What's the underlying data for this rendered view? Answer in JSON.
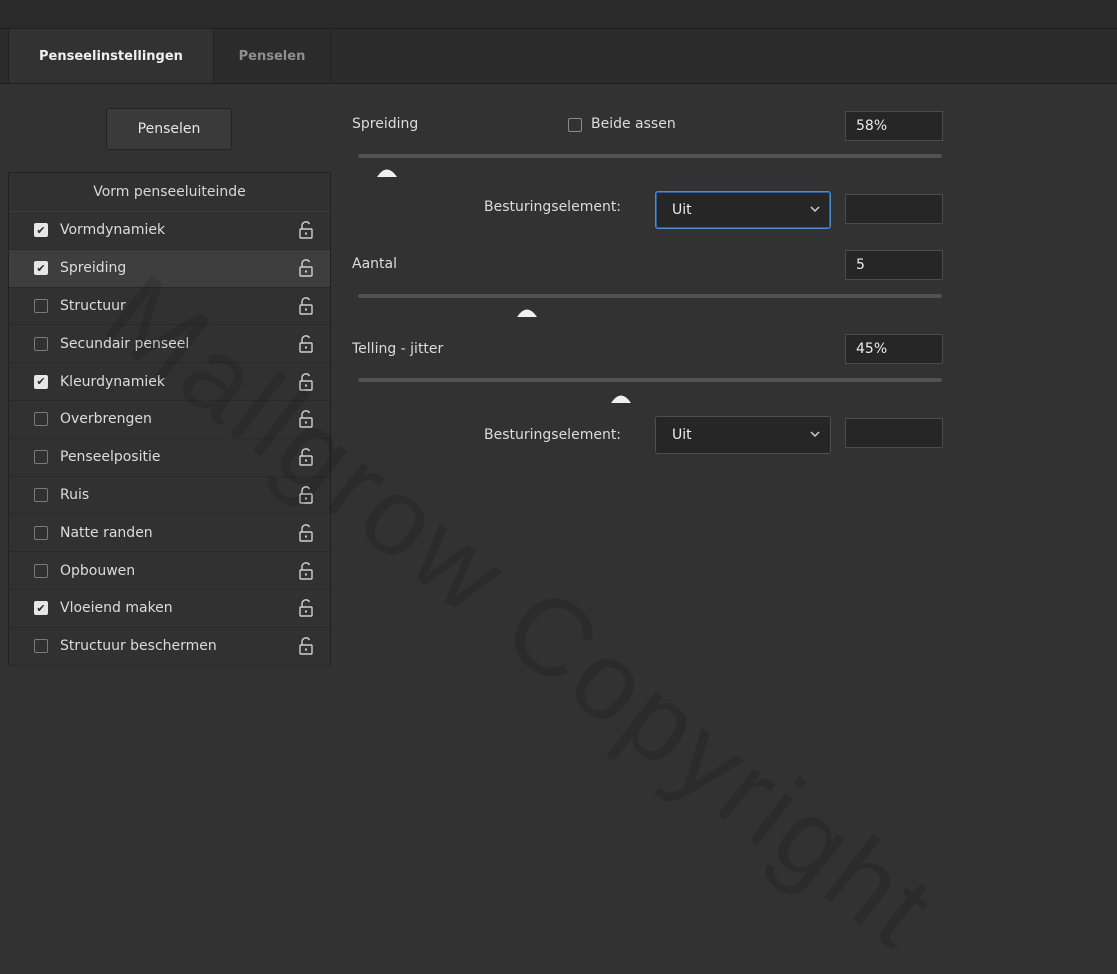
{
  "tabs": [
    {
      "label": "Penseelinstellingen",
      "active": true
    },
    {
      "label": "Penselen",
      "active": false
    }
  ],
  "brushes_button": "Penselen",
  "brush_tip_shape": "Vorm penseeluiteinde",
  "options": [
    {
      "label": "Vormdynamiek",
      "checked": true
    },
    {
      "label": "Spreiding",
      "checked": true,
      "selected": true
    },
    {
      "label": "Structuur",
      "checked": false
    },
    {
      "label": "Secundair penseel",
      "checked": false
    },
    {
      "label": "Kleurdynamiek",
      "checked": true
    },
    {
      "label": "Overbrengen",
      "checked": false
    },
    {
      "label": "Penseelpositie",
      "checked": false
    },
    {
      "label": "Ruis",
      "checked": false
    },
    {
      "label": "Natte randen",
      "checked": false
    },
    {
      "label": "Opbouwen",
      "checked": false
    },
    {
      "label": "Vloeiend maken",
      "checked": true
    },
    {
      "label": "Structuur beschermen",
      "checked": false
    }
  ],
  "scatter": {
    "label": "Spreiding",
    "both_axes_label": "Beide assen",
    "both_axes_checked": false,
    "value": "58%",
    "slider_fraction": 0.05,
    "control_label": "Besturingselement:",
    "control_value": "Uit",
    "control_field": ""
  },
  "count": {
    "label": "Aantal",
    "value": "5",
    "slider_fraction": 0.29
  },
  "count_jitter": {
    "label": "Telling - jitter",
    "value": "45%",
    "slider_fraction": 0.45,
    "control_label": "Besturingselement:",
    "control_value": "Uit",
    "control_field": ""
  },
  "watermark": "Mallgrow Copyright",
  "colors": {
    "background": "#323232",
    "focus_blue": "#4a8bd6",
    "checkbox_checked": "#e6e6e6"
  }
}
